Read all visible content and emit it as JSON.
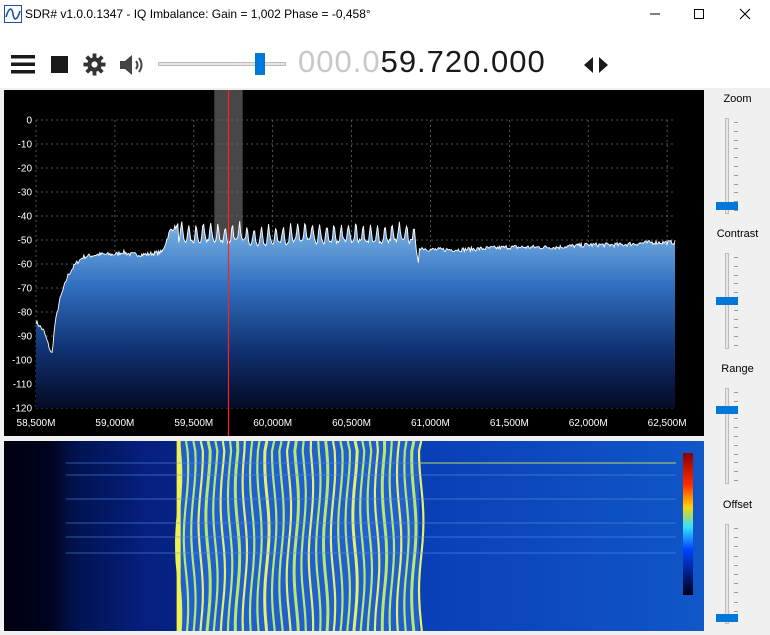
{
  "window": {
    "title": "SDR# v1.0.0.1347 - IQ Imbalance: Gain = 1,002 Phase = -0,458°",
    "minimize_glyph": "–",
    "maximize_glyph": "☐",
    "close_glyph": "✕"
  },
  "toolbar": {
    "menu_icon": "hamburger-menu-icon",
    "stop_icon": "stop-square-icon",
    "settings_icon": "gear-icon",
    "audio_icon": "speaker-icon",
    "volume_level": 0.82,
    "frequency_dim": "000.0",
    "frequency_lit": "59.720.000",
    "tune_arrows_icon": "left-right-arrows-icon"
  },
  "sidebar": {
    "zoom_label": "Zoom",
    "zoom_level": 0.05,
    "contrast_label": "Contrast",
    "contrast_level": 0.5,
    "range_label": "Range",
    "range_level": 0.8,
    "offset_label": "Offset",
    "offset_level": 0.02
  },
  "chart_data": {
    "type": "area",
    "y_ticks": [
      "0",
      "-10",
      "-20",
      "-30",
      "-40",
      "-50",
      "-60",
      "-70",
      "-80",
      "-90",
      "-100",
      "-110",
      "-120"
    ],
    "x_ticks": [
      "58,500M",
      "59,000M",
      "59,500M",
      "60,000M",
      "60,500M",
      "61,000M",
      "61,500M",
      "62,000M",
      "62,500M"
    ],
    "xlim": [
      58.5,
      62.55
    ],
    "ylim": [
      -120,
      0
    ],
    "grid": true,
    "tuned_frequency": 59.72,
    "filter_band": [
      59.63,
      59.81
    ],
    "x": [
      58.5,
      58.55,
      58.6,
      58.62,
      58.65,
      58.7,
      58.75,
      58.8,
      58.9,
      59.0,
      59.05,
      59.1,
      59.2,
      59.3,
      59.35,
      59.4,
      59.5,
      59.6,
      59.7,
      59.8,
      59.9,
      60.0,
      60.1,
      60.2,
      60.3,
      60.4,
      60.5,
      60.6,
      60.7,
      60.8,
      60.9,
      60.92,
      61.0,
      61.2,
      61.5,
      61.8,
      62.0,
      62.2,
      62.4,
      62.55
    ],
    "y": [
      -84,
      -88,
      -98,
      -85,
      -75,
      -65,
      -60,
      -57,
      -56,
      -56,
      -55,
      -56,
      -56,
      -55,
      -46,
      -44,
      -45,
      -44,
      -45,
      -44,
      -46,
      -45,
      -45,
      -44,
      -45,
      -45,
      -44,
      -45,
      -45,
      -44,
      -45,
      -53,
      -54,
      -54,
      -53,
      -53,
      -52,
      -52,
      -51,
      -51
    ],
    "waterfall_band": [
      59.4,
      60.93
    ]
  }
}
